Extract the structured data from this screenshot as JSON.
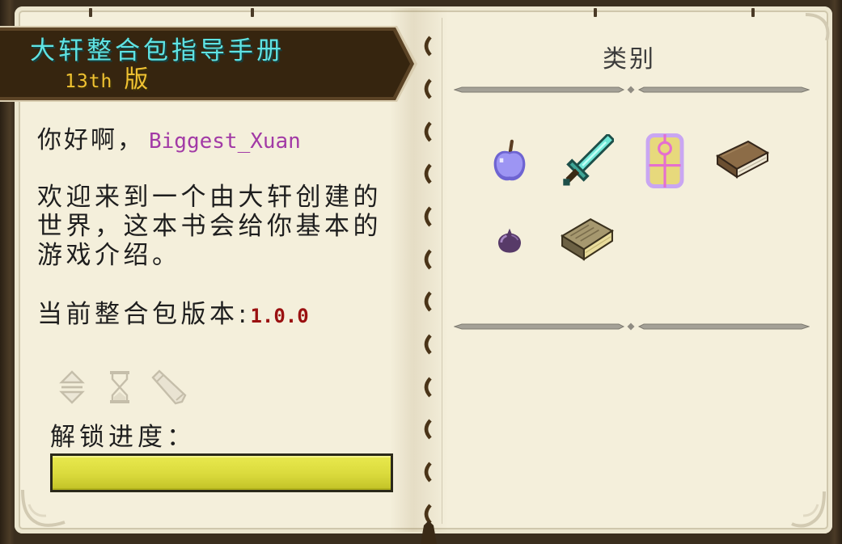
{
  "book": {
    "title": "大轩整合包指导手册",
    "edition_number": "13th",
    "edition_suffix": "版"
  },
  "left_page": {
    "greeting": "你好啊，",
    "player_name": "Biggest_Xuan",
    "intro_lines": [
      "欢迎来到一个由大轩创建的",
      "世界，这本书会给你基本的",
      "游戏介绍。"
    ],
    "version_label": "当前整合包版本:",
    "version_value": "1.0.0",
    "tool_buttons": [
      {
        "icon": "sort-arrows-icon"
      },
      {
        "icon": "hourglass-icon"
      },
      {
        "icon": "pencil-icon"
      }
    ],
    "progress_label": "解锁进度：",
    "unlock_progress": 1.0
  },
  "right_page": {
    "title": "类别",
    "categories": [
      {
        "icon": "purple-apple-icon"
      },
      {
        "icon": "diamond-sword-icon"
      },
      {
        "icon": "talisman-icon"
      },
      {
        "icon": "book-icon"
      },
      {
        "icon": "purple-orb-icon"
      },
      {
        "icon": "old-book-icon"
      }
    ]
  },
  "colors": {
    "title": "#5FE3E3",
    "edition": "#F0C232",
    "player_name": "#A23AA6",
    "version": "#9A1010",
    "text": "#1E1E1E",
    "heading": "#3B3B3B",
    "progress_fill": "#DADA3C",
    "parchment": "#F4EFDB",
    "banner": "#36250F"
  }
}
